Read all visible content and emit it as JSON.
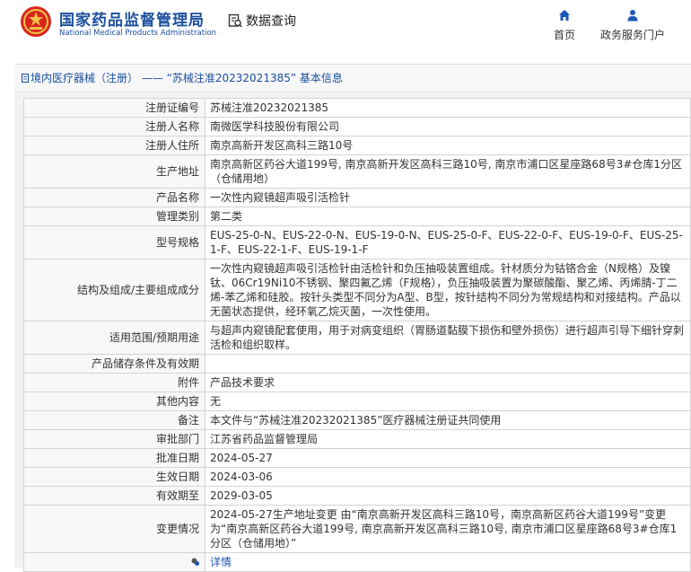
{
  "header": {
    "logo_cn": "国家药品监督管理局",
    "logo_en": "National Medical Products Administration",
    "query_label": "数据查询",
    "nav": {
      "home": "首页",
      "portal": "政务服务门户"
    }
  },
  "breadcrumb": {
    "part1": "境内医疗器械（注册）",
    "sep": " —— ",
    "part2": "“苏械注准20232021385”",
    "part3": " 基本信息"
  },
  "fields": [
    {
      "label": "注册证编号",
      "value": "苏械注准20232021385"
    },
    {
      "label": "注册人名称",
      "value": "南微医学科技股份有限公司"
    },
    {
      "label": "注册人住所",
      "value": "南京高新开发区高科三路10号"
    },
    {
      "label": "生产地址",
      "value": "南京高新区药谷大道199号, 南京高新开发区高科三路10号, 南京市浦口区星座路68号3#仓库1分区（仓储用地）"
    },
    {
      "label": "产品名称",
      "value": "一次性内窥镜超声吸引活检针"
    },
    {
      "label": "管理类别",
      "value": "第二类"
    },
    {
      "label": "型号规格",
      "value": "EUS-25-0-N、EUS-22-0-N、EUS-19-0-N、EUS-25-0-F、EUS-22-0-F、EUS-19-0-F、EUS-25-1-F、EUS-22-1-F、EUS-19-1-F"
    },
    {
      "label": "结构及组成/主要组成成分",
      "value": "一次性内窥镜超声吸引活检针由活检针和负压抽吸装置组成。针材质分为钴铬合金（N规格）及镍钛、06Cr19Ni10不锈钢、聚四氟乙烯（F规格），负压抽吸装置为聚碳酸酯、聚乙烯、丙烯腈-丁二烯-苯乙烯和硅胶。按针头类型不同分为A型、B型，按针结构不同分为常规结构和对接结构。产品以无菌状态提供，经环氧乙烷灭菌，一次性使用。"
    },
    {
      "label": "适用范围/预期用途",
      "value": "与超声内窥镜配套使用，用于对病变组织（胃肠道黏膜下损伤和壁外损伤）进行超声引导下细针穿刺活检和组织取样。"
    },
    {
      "label": "产品储存条件及有效期",
      "value": ""
    },
    {
      "label": "附件",
      "value": "产品技术要求"
    },
    {
      "label": "其他内容",
      "value": "无"
    },
    {
      "label": "备注",
      "value": "本文件与“苏械注准20232021385”医疗器械注册证共同使用"
    },
    {
      "label": "审批部门",
      "value": "江苏省药品监督管理局"
    },
    {
      "label": "批准日期",
      "value": "2024-05-27"
    },
    {
      "label": "生效日期",
      "value": "2024-03-06"
    },
    {
      "label": "有效期至",
      "value": "2029-03-05"
    },
    {
      "label": "变更情况",
      "value": "2024-05-27生产地址变更 由“南京高新开发区高科三路10号，南京高新区药谷大道199号”变更为“南京高新区药谷大道199号, 南京高新开发区高科三路10号, 南京市浦口区星座路68号3#仓库1分区（仓储用地）”"
    }
  ],
  "detail": {
    "link_text": "详情"
  },
  "icons": [
    "emblem-icon",
    "query-icon",
    "home-icon",
    "user-icon",
    "doc-icon",
    "pin-icon"
  ],
  "colors": {
    "brand": "#1b4f9c",
    "link": "#1e56b8",
    "nav_icon": "#1d57b5"
  }
}
